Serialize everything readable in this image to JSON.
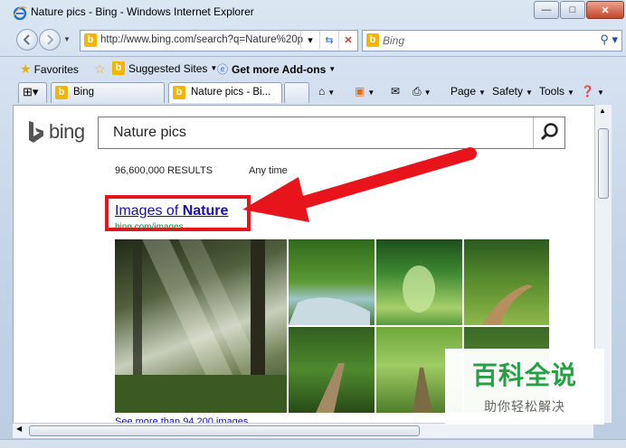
{
  "window": {
    "title": "Nature pics - Bing - Windows Internet Explorer",
    "buttons": {
      "minimize": "—",
      "maximize": "□",
      "close": "✕"
    }
  },
  "nav": {
    "address": "http://www.bing.com/search?q=Nature%20p",
    "search_placeholder": "Bing"
  },
  "favorites_bar": {
    "favorites": "Favorites",
    "suggested": "Suggested Sites",
    "addons": "Get more Add-ons"
  },
  "tabs": [
    {
      "label": "Bing",
      "active": false
    },
    {
      "label": "Nature pics - Bi...",
      "active": true
    }
  ],
  "commands": {
    "page": "Page",
    "safety": "Safety",
    "tools": "Tools"
  },
  "page": {
    "logo_text": "bing",
    "query": "Nature pics",
    "results_count": "96,600,000 RESULTS",
    "any_time": "Any time",
    "images_link_prefix": "Images of ",
    "images_link_bold": "Nature",
    "source_url": "bing.com/images",
    "see_more": "See more than 94,200 images"
  },
  "watermark": {
    "title": "百科全说",
    "subtitle": "助你轻松解决"
  },
  "colors": {
    "highlight_box": "#e8141b",
    "bing_accent": "#f4b400",
    "link": "#1a0dab",
    "watermark_green": "#27a046"
  }
}
